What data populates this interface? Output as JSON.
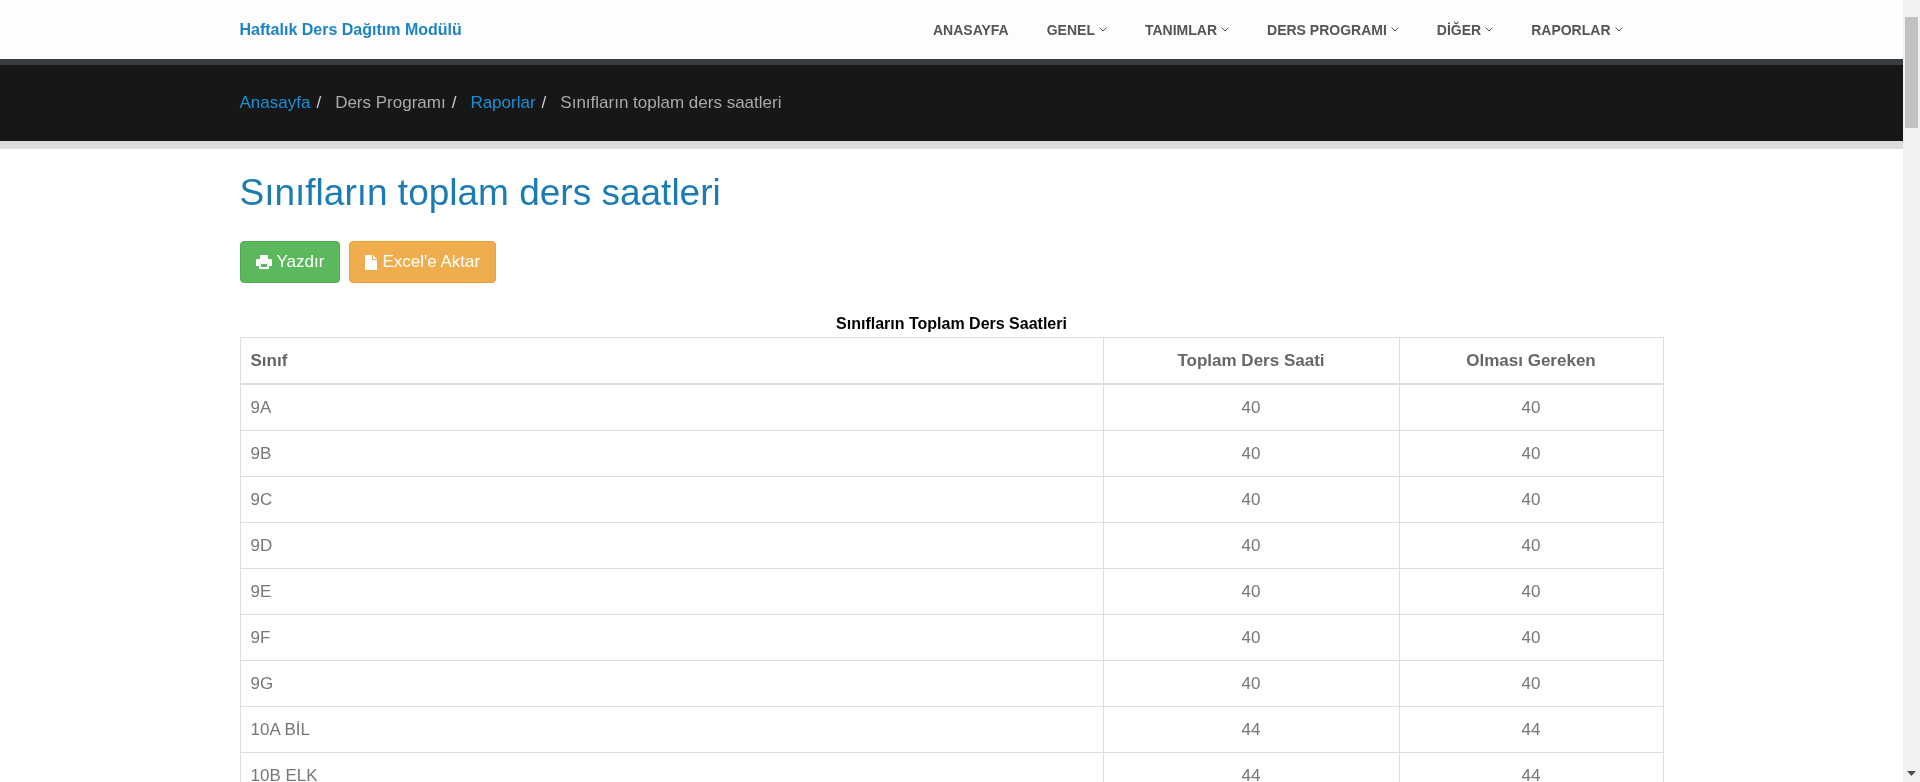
{
  "navbar": {
    "brand": "Haftalık Ders Dağıtım Modülü",
    "items": [
      {
        "label": "ANASAYFA",
        "dropdown": false
      },
      {
        "label": "GENEL",
        "dropdown": true
      },
      {
        "label": "TANIMLAR",
        "dropdown": true
      },
      {
        "label": "DERS PROGRAMI",
        "dropdown": true
      },
      {
        "label": "DİĞER",
        "dropdown": true
      },
      {
        "label": "RAPORLAR",
        "dropdown": true
      }
    ]
  },
  "breadcrumb_separator": "/",
  "breadcrumb": [
    {
      "label": "Anasayfa",
      "link": true
    },
    {
      "label": "Ders Programı",
      "link": false
    },
    {
      "label": "Raporlar",
      "link": true
    },
    {
      "label": "Sınıfların toplam ders saatleri",
      "link": false
    }
  ],
  "page_title": "Sınıfların toplam ders saatleri",
  "buttons": [
    {
      "kind": "print",
      "label": "Yazdır"
    },
    {
      "kind": "excel",
      "label": "Excel'e Aktar"
    }
  ],
  "table": {
    "caption": "Sınıfların Toplam Ders Saatleri",
    "columns": [
      "Sınıf",
      "Toplam Ders Saati",
      "Olması Gereken"
    ],
    "rows": [
      [
        "9A",
        "40",
        "40"
      ],
      [
        "9B",
        "40",
        "40"
      ],
      [
        "9C",
        "40",
        "40"
      ],
      [
        "9D",
        "40",
        "40"
      ],
      [
        "9E",
        "40",
        "40"
      ],
      [
        "9F",
        "40",
        "40"
      ],
      [
        "9G",
        "40",
        "40"
      ],
      [
        "10A BİL",
        "44",
        "44"
      ],
      [
        "10B ELK",
        "44",
        "44"
      ]
    ]
  }
}
